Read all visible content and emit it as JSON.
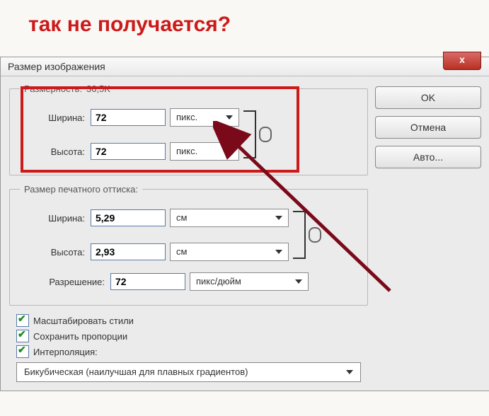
{
  "headline": "так не получается?",
  "window_title": "Размер изображения",
  "close_x": "x",
  "sections": {
    "pixel_dim": {
      "legend": "Размерность:",
      "size_text": "36,5K"
    },
    "print_dim": {
      "legend": "Размер печатного оттиска:"
    }
  },
  "labels": {
    "width": "Ширина:",
    "height": "Высота:",
    "resolution": "Разрешение:"
  },
  "units": {
    "px": "пикс.",
    "cm": "см",
    "ppi": "пикс/дюйм"
  },
  "pixel": {
    "width": "72",
    "height": "72"
  },
  "print": {
    "width": "5,29",
    "height": "2,93",
    "resolution": "72"
  },
  "checkboxes": {
    "scale_styles": "Масштабировать стили",
    "constrain": "Сохранить пропорции",
    "resample": "Интерполяция:"
  },
  "interp_value": "Бикубическая (наилучшая для плавных градиентов)",
  "buttons": {
    "ok": "OK",
    "cancel": "Отмена",
    "auto": "Авто..."
  }
}
